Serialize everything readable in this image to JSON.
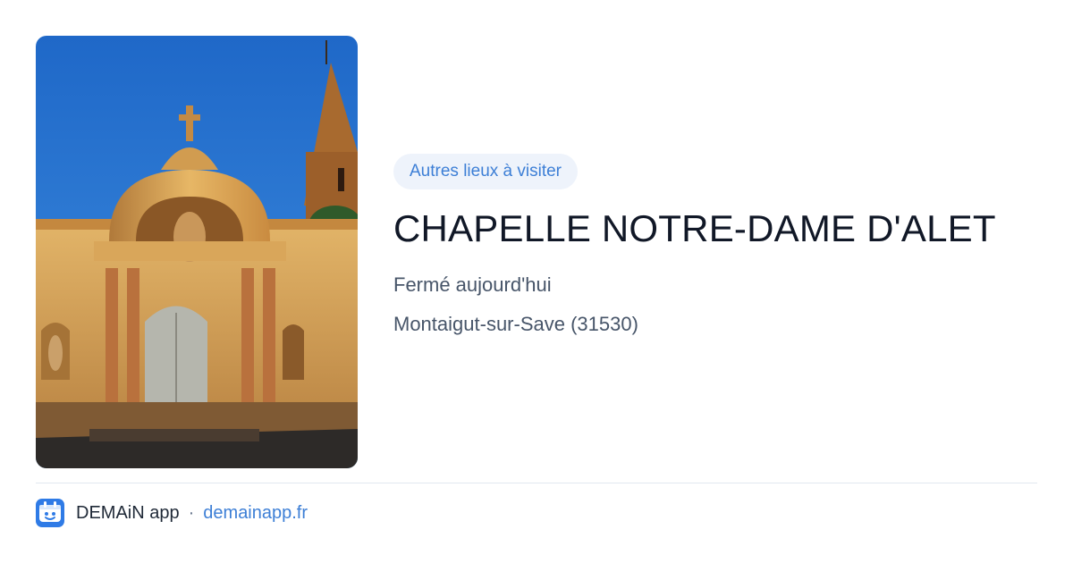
{
  "card": {
    "image_alt": "Chapelle Notre-Dame d'Alet",
    "category": "Autres lieux à visiter",
    "title": "CHAPELLE NOTRE-DAME D'ALET",
    "status": "Fermé aujourd'hui",
    "location": "Montaigut-sur-Save (31530)"
  },
  "footer": {
    "app_name": "DEMAiN app",
    "separator": "·",
    "url": "demainapp.fr",
    "logo_icon": "app-logo-icon"
  },
  "colors": {
    "accent": "#3d7fd6",
    "pill_bg": "#eef3fb",
    "title": "#111827",
    "muted": "#475569",
    "divider": "#e2e8f0"
  }
}
